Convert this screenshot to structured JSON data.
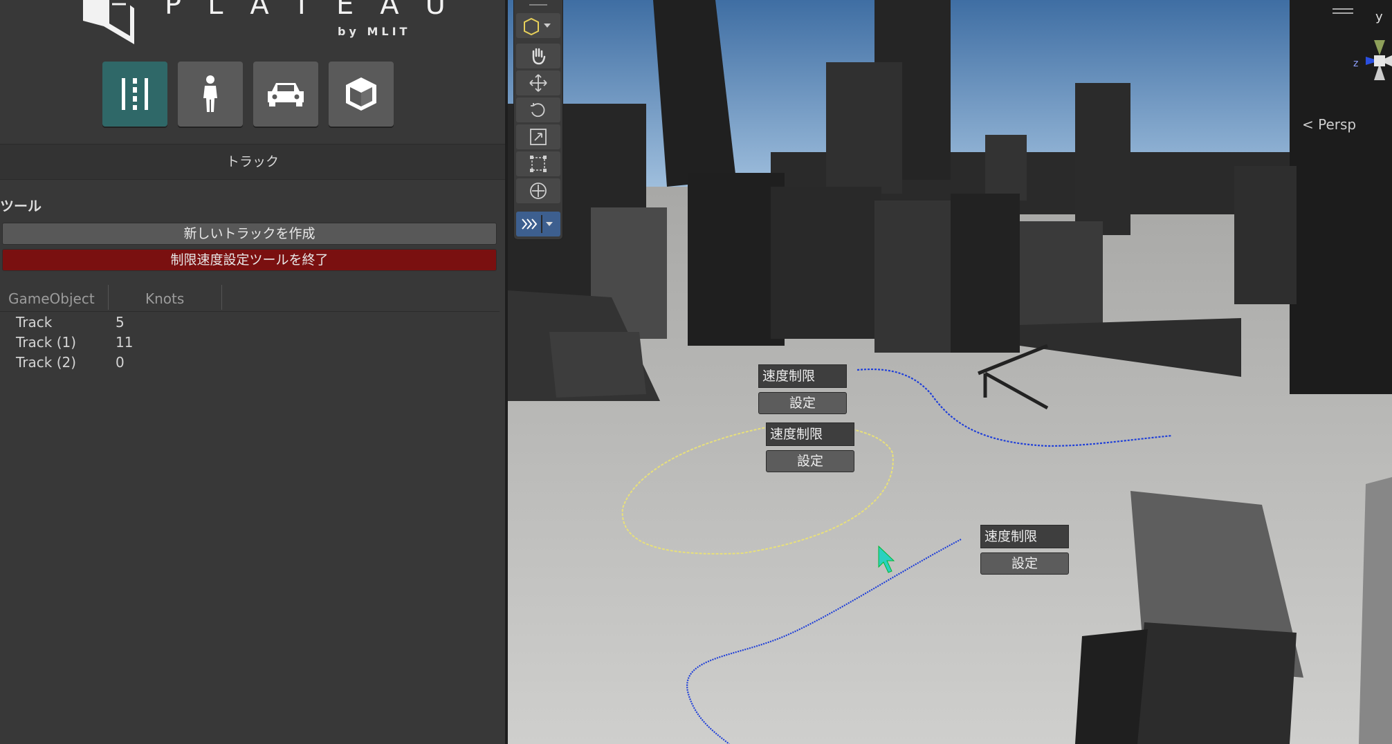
{
  "logo": {
    "title": "PLATEAU",
    "subtitle": "by MLIT"
  },
  "modes": [
    {
      "name": "track-mode-button",
      "icon": "road-lanes-icon",
      "active": true
    },
    {
      "name": "pedestrian-mode-button",
      "icon": "pedestrian-icon",
      "active": false
    },
    {
      "name": "vehicle-mode-button",
      "icon": "car-icon",
      "active": false
    },
    {
      "name": "object-mode-button",
      "icon": "cube-icon",
      "active": false
    }
  ],
  "section_title": "トラック",
  "tools": {
    "label": "ツール",
    "new_track": "新しいトラックを作成",
    "end_speed_tool": "制限速度設定ツールを終了"
  },
  "table": {
    "headers": [
      "GameObject",
      "Knots"
    ],
    "rows": [
      {
        "name": "Track",
        "knots": "5"
      },
      {
        "name": "Track (1)",
        "knots": "11"
      },
      {
        "name": "Track (2)",
        "knots": "0"
      }
    ]
  },
  "scene": {
    "speed_panels": [
      {
        "label": "速度制限",
        "button": "設定"
      },
      {
        "label": "速度制限",
        "button": "設定"
      },
      {
        "label": "速度制限",
        "button": "設定"
      }
    ],
    "gizmo": {
      "y_label": "y",
      "z_label": "z",
      "projection": "Persp"
    }
  },
  "colors": {
    "active_mode": "#2f6868",
    "end_button": "#7a1010",
    "track_blue": "#1f3fd8",
    "track_yellow": "#e8e07a"
  }
}
